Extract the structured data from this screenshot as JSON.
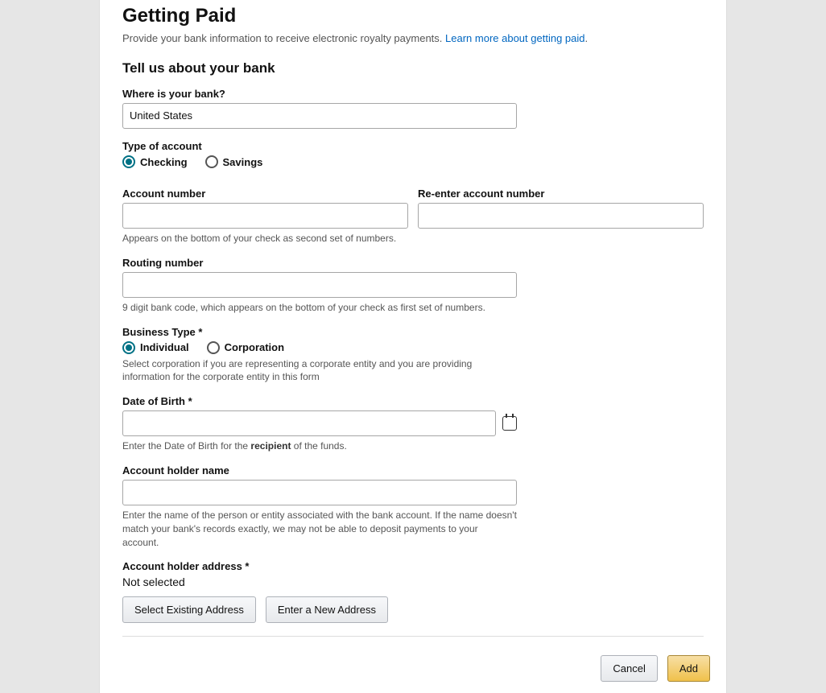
{
  "header": {
    "title": "Getting Paid",
    "desc": "Provide your bank information to receive electronic royalty payments. ",
    "link": "Learn more about getting paid"
  },
  "section": {
    "title": "Tell us about your bank"
  },
  "bank_location": {
    "label": "Where is your bank?",
    "value": "United States"
  },
  "account_type": {
    "label": "Type of account",
    "checking": "Checking",
    "savings": "Savings"
  },
  "account_number": {
    "label": "Account number",
    "reenter_label": "Re-enter account number",
    "hint": "Appears on the bottom of your check as second set of numbers."
  },
  "routing": {
    "label": "Routing number",
    "hint": "9 digit bank code, which appears on the bottom of your check as first set of numbers."
  },
  "business_type": {
    "label": "Business Type *",
    "individual": "Individual",
    "corporation": "Corporation",
    "hint": "Select corporation if you are representing a corporate entity and you are providing information for the corporate entity in this form"
  },
  "dob": {
    "label": "Date of Birth *",
    "hint_pre": "Enter the Date of Birth for the ",
    "hint_bold": "recipient",
    "hint_post": " of the funds."
  },
  "holder_name": {
    "label": "Account holder name",
    "hint": "Enter the name of the person or entity associated with the bank account. If the name doesn't match your bank's records exactly, we may not be able to deposit payments to your account."
  },
  "holder_address": {
    "label": "Account holder address *",
    "value": "Not selected",
    "select_existing": "Select Existing Address",
    "enter_new": "Enter a New Address"
  },
  "footer": {
    "cancel": "Cancel",
    "add": "Add"
  }
}
